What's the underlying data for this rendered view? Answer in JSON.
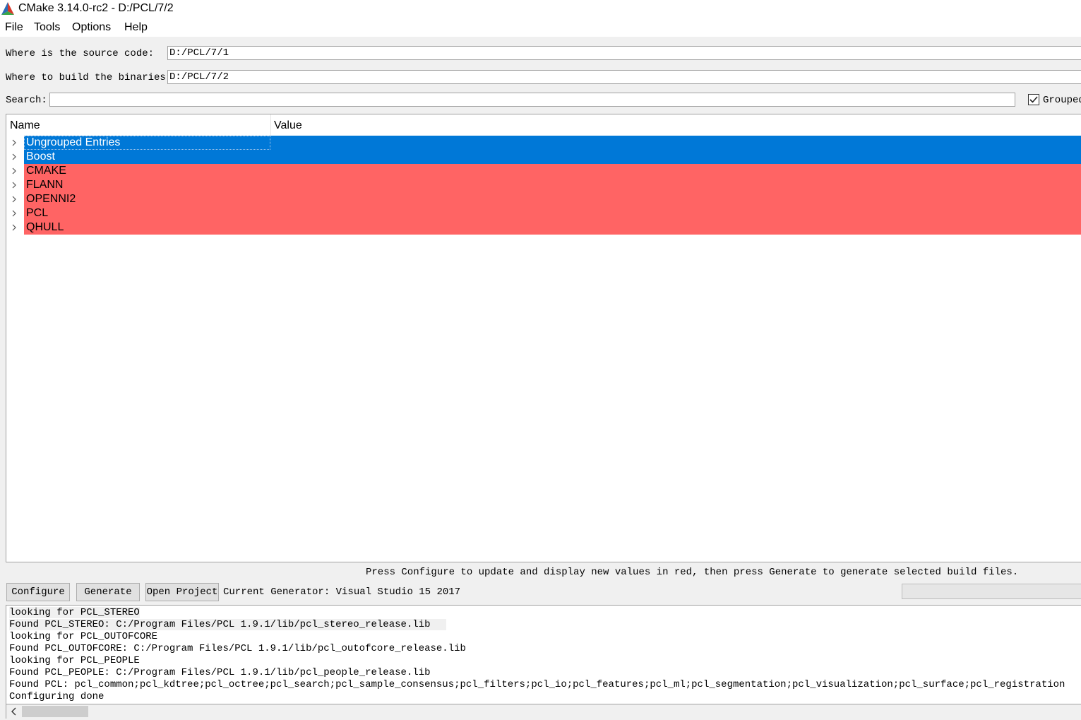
{
  "window": {
    "title": "CMake 3.14.0-rc2 - D:/PCL/7/2",
    "icon": "cmake-logo"
  },
  "menu": [
    "File",
    "Tools",
    "Options",
    "Help"
  ],
  "paths": {
    "source_label": "Where is the source code:",
    "source_value": "D:/PCL/7/1",
    "build_label": "Where to build the binaries:",
    "build_value": "D:/PCL/7/2"
  },
  "search": {
    "label": "Search:",
    "value": "",
    "grouped_label": "Grouped",
    "grouped_checked": true
  },
  "tree": {
    "headers": {
      "name": "Name",
      "value": "Value"
    },
    "rows": [
      {
        "name": "Ungrouped Entries",
        "state": "selected"
      },
      {
        "name": "Boost",
        "state": "selected"
      },
      {
        "name": "CMAKE",
        "state": "new"
      },
      {
        "name": "FLANN",
        "state": "new"
      },
      {
        "name": "OPENNI2",
        "state": "new"
      },
      {
        "name": "PCL",
        "state": "new"
      },
      {
        "name": "QHULL",
        "state": "new"
      }
    ]
  },
  "hint": "Press Configure to update and display new values in red, then press Generate to generate selected build files.",
  "buttons": {
    "configure": "Configure",
    "generate": "Generate",
    "open_project": "Open Project"
  },
  "generator": "Current Generator: Visual Studio 15 2017",
  "colors": {
    "selection": "#0078d7",
    "new_entry": "#ff6464"
  },
  "output": {
    "lines": [
      "looking for PCL_STEREO",
      "Found PCL_STEREO: C:/Program Files/PCL 1.9.1/lib/pcl_stereo_release.lib",
      "looking for PCL_OUTOFCORE",
      "Found PCL_OUTOFCORE: C:/Program Files/PCL 1.9.1/lib/pcl_outofcore_release.lib",
      "looking for PCL_PEOPLE",
      "Found PCL_PEOPLE: C:/Program Files/PCL 1.9.1/lib/pcl_people_release.lib",
      "Found PCL: pcl_common;pcl_kdtree;pcl_octree;pcl_search;pcl_sample_consensus;pcl_filters;pcl_io;pcl_features;pcl_ml;pcl_segmentation;pcl_visualization;pcl_surface;pcl_registration",
      "Configuring done"
    ]
  }
}
